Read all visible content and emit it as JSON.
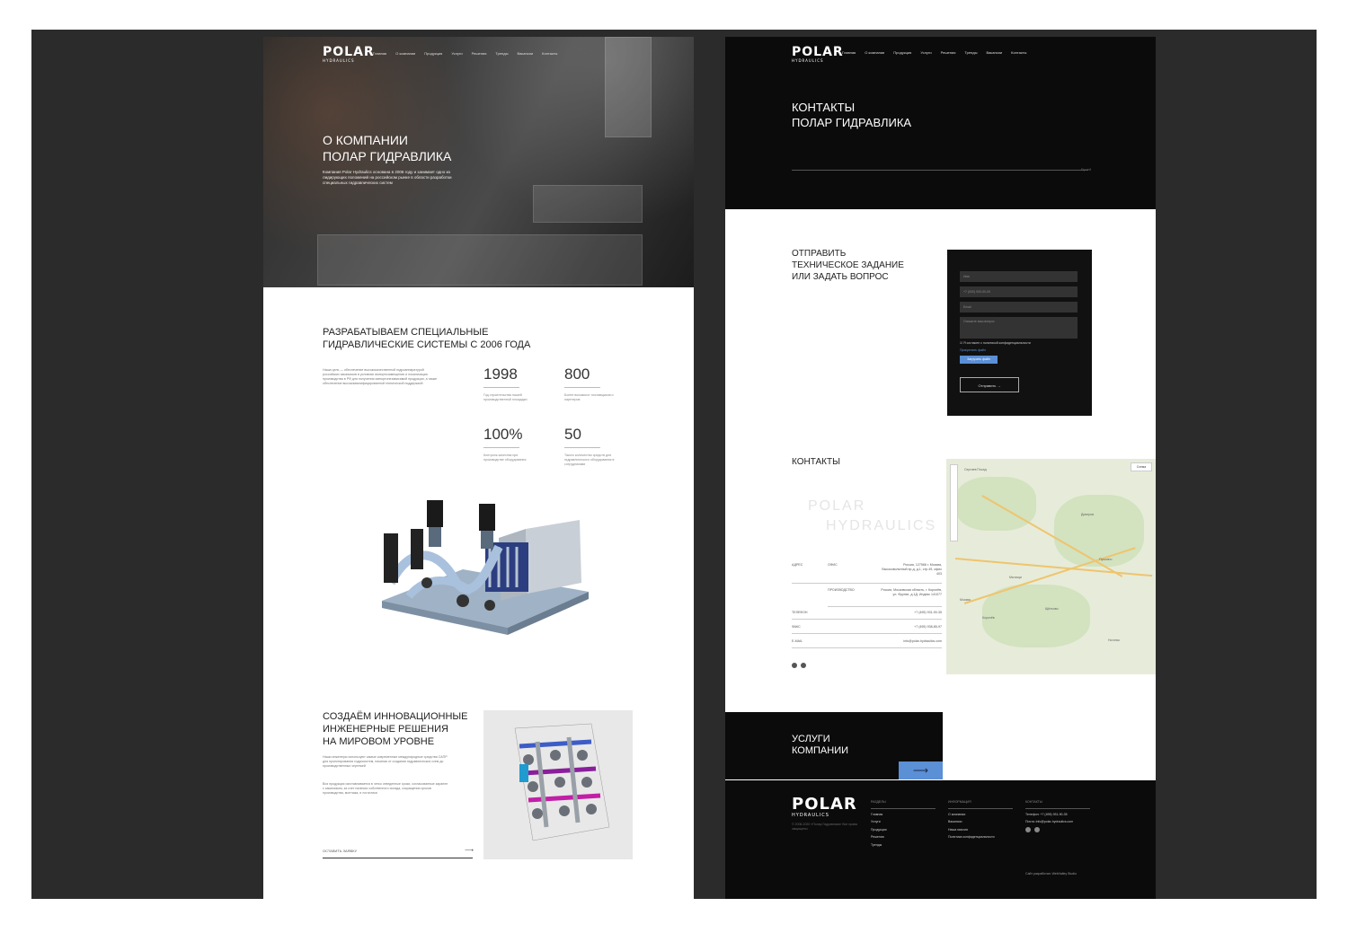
{
  "brand": {
    "logo_main": "POLAR",
    "logo_sub": "HYDRAULICS"
  },
  "nav": [
    "Главная",
    "О компании",
    "Продукция",
    "Услуги",
    "Решения",
    "Тренды",
    "Вакансии",
    "Контакты"
  ],
  "left": {
    "hero_title_1": "О КОМПАНИИ",
    "hero_title_2": "ПОЛАР ГИДРАВЛИКА",
    "hero_text": "Компания Polar Hydraulics основана в 2006 году и занимает одно из лидирующих положений на российском рынке в области разработки специальных гидравлических систем",
    "section1_title_1": "РАЗРАБАТЫВАЕМ СПЕЦИАЛЬНЫЕ",
    "section1_title_2": "ГИДРАВЛИЧЕСКИЕ СИСТЕМЫ С 2006 ГОДА",
    "section1_text": "Наша цель — обеспечение высококачественной гидроаппаратурой российских заказчиков в условиях импортозамещения и локализация производства в РФ для получения импортонезависимой продукции, а также обеспечение высококвалифицированной технической поддержкой",
    "stats": [
      {
        "value": "1998",
        "caption": "Год строительства нашей производственной площадки"
      },
      {
        "value": "800",
        "caption": "Более восьмисот поставщиков и партнеров"
      },
      {
        "value": "100%",
        "caption": "Контроль качества при производстве оборудования"
      },
      {
        "value": "50",
        "caption": "Такого количество средств для гидравлического оборудования в сотрудниками"
      }
    ],
    "section2_title_1": "СОЗДАЁМ ИННОВАЦИОННЫЕ",
    "section2_title_2": "ИНЖЕНЕРНЫЕ РЕШЕНИЯ",
    "section2_title_3": "НА МИРОВОМ УРОВНЕ",
    "section2_text_1": "Наши инженеры используют самые современные международные средства САПР для проектирования гидросистем, начиная от создания гидравлических схем до производственных чертежей",
    "section2_text_2": "Вся продукция изготавливается в четко отведенные сроки, согласованные заранее с заказчиком, за счет наличия собственного склада, сокращения сроков производства, монтажа, и логистики",
    "cta_link": "ОСТАВИТЬ ЗАЯВКУ",
    "cta_arrow": "⟶"
  },
  "right": {
    "header_title_1": "КОНТАКТЫ",
    "header_title_2": "ПОЛАР ГИДРАВЛИКА",
    "header_tag": "Ручей",
    "form_title_1": "ОТПРАВИТЬ",
    "form_title_2": "ТЕХНИЧЕСКОЕ ЗАДАНИЕ",
    "form_title_3": "ИЛИ ЗАДАТЬ ВОПРОС",
    "form": {
      "name_placeholder": "Имя",
      "phone_placeholder": "+7 (000) 000-00-00",
      "email_placeholder": "Email",
      "message_placeholder": "Опишите ваш вопрос",
      "consent": "Я согласен с политикой конфиденциальности",
      "attach_label": "Прикрепить файл",
      "file_button": "Загрузить файл",
      "submit": "Отправить →"
    },
    "contacts_title": "КОНТАКТЫ",
    "ghost_logo_1": "POLAR",
    "ghost_logo_2": "HYDRAULICS",
    "contacts": {
      "address_label": "АДРЕС",
      "office_label": "ОФИС",
      "office_value": "Россия, 127566 г. Москва, Высоковольтный пр-д, д.1, стр.49, офис 403",
      "production_label": "ПРОИЗВОДСТВО",
      "production_value": "Россия, Московская область, г. Королёв, ул. Фрунзе, д.1Д, Индекс 141077",
      "phone_label": "ТЕЛЕФОН",
      "phone_value": "+7 (495) 931-90-35",
      "fax_label": "ФАКС",
      "fax_value": "+7 (495) 938-85-97",
      "email_label": "E-MAIL",
      "email_value": "info@polar-hydraulics.com"
    },
    "map_layers": "Схема",
    "map_cities": [
      "Сергиев Посад",
      "Королёв",
      "Москва",
      "Мытищи",
      "Щёлково",
      "Дмитров",
      "Пушкино",
      "Ногинск"
    ],
    "services_title_1": "УСЛУГИ",
    "services_title_2": "КОМПАНИИ",
    "services_arrow": "⟶",
    "footer": {
      "copyright": "© 2006-2020 «Полар Гидравлика» Все права защищены",
      "col1_title": "РАЗДЕЛЫ",
      "col1": [
        "Главная",
        "Услуги",
        "Продукция",
        "Решения",
        "Тренды"
      ],
      "col2_title": "ИНФОРМАЦИЯ",
      "col2": [
        "О компании",
        "Вакансии",
        "Наша миссия",
        "Политика конфиденциальности"
      ],
      "col3_title": "КОНТАКТЫ",
      "col3": [
        "Телефон: +7 (495) 931-90-35",
        "Почта: info@polar-hydraulics.com"
      ],
      "made_by": "Сайт разработан: WebValley Studio"
    }
  }
}
